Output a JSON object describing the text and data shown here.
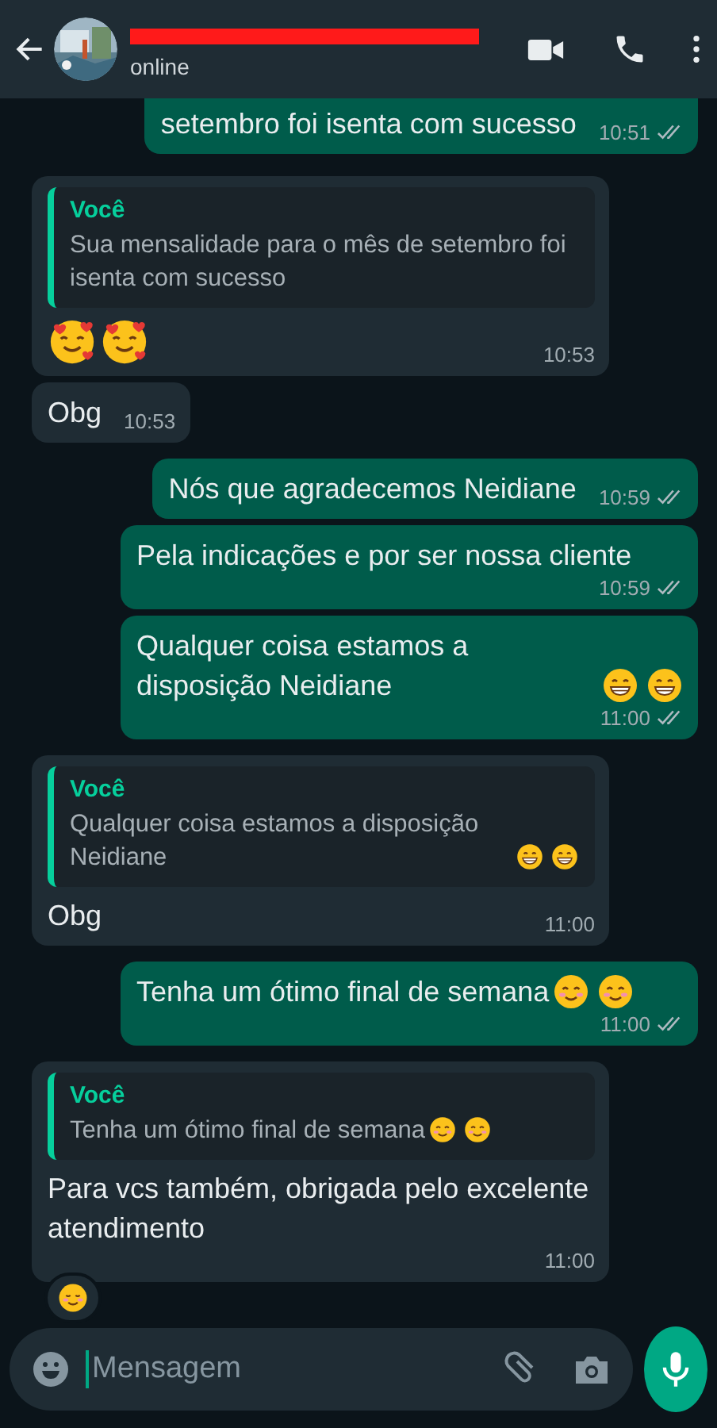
{
  "header": {
    "title_redacted": true,
    "status": "online"
  },
  "messages": [
    {
      "kind": "outgoing",
      "text": "setembro foi isenta com sucesso",
      "time": "10:51",
      "read": false,
      "clipped": true
    },
    {
      "kind": "incoming",
      "quote": {
        "author": "Você",
        "text": "Sua mensalidade para o mês de setembro foi isenta com sucesso"
      },
      "emojis": [
        {
          "kind": "hearts"
        },
        {
          "kind": "hearts"
        }
      ],
      "time": "10:53"
    },
    {
      "kind": "incoming",
      "text": "Obg",
      "time": "10:53"
    },
    {
      "kind": "outgoing",
      "text": "Nós que agradecemos Neidiane",
      "time": "10:59",
      "read": false
    },
    {
      "kind": "outgoing",
      "text": "Pela indicações e por ser nossa cliente",
      "time": "10:59",
      "read": false
    },
    {
      "kind": "outgoing",
      "text": "Qualquer coisa estamos a disposição Neidiane",
      "emojis": [
        {
          "kind": "grin"
        },
        {
          "kind": "grin"
        }
      ],
      "time": "11:00",
      "read": false
    },
    {
      "kind": "incoming",
      "quote": {
        "author": "Você",
        "text": "Qualquer coisa estamos a disposição Neidiane",
        "emojis": [
          {
            "kind": "grin"
          },
          {
            "kind": "grin"
          }
        ]
      },
      "text": "Obg",
      "time": "11:00"
    },
    {
      "kind": "outgoing",
      "text": "Tenha um ótimo final de semana",
      "emojis": [
        {
          "kind": "smile"
        },
        {
          "kind": "smile"
        }
      ],
      "time": "11:00",
      "read": false
    },
    {
      "kind": "incoming",
      "quote": {
        "author": "Você",
        "text": "Tenha um ótimo final de semana",
        "emojis": [
          {
            "kind": "smile"
          },
          {
            "kind": "smile"
          }
        ]
      },
      "text": "Para vcs também, obrigada pelo excelente atendimento",
      "time": "11:00",
      "reactions": [
        {
          "kind": "blush"
        }
      ]
    }
  ],
  "composer": {
    "placeholder": "Mensagem"
  }
}
